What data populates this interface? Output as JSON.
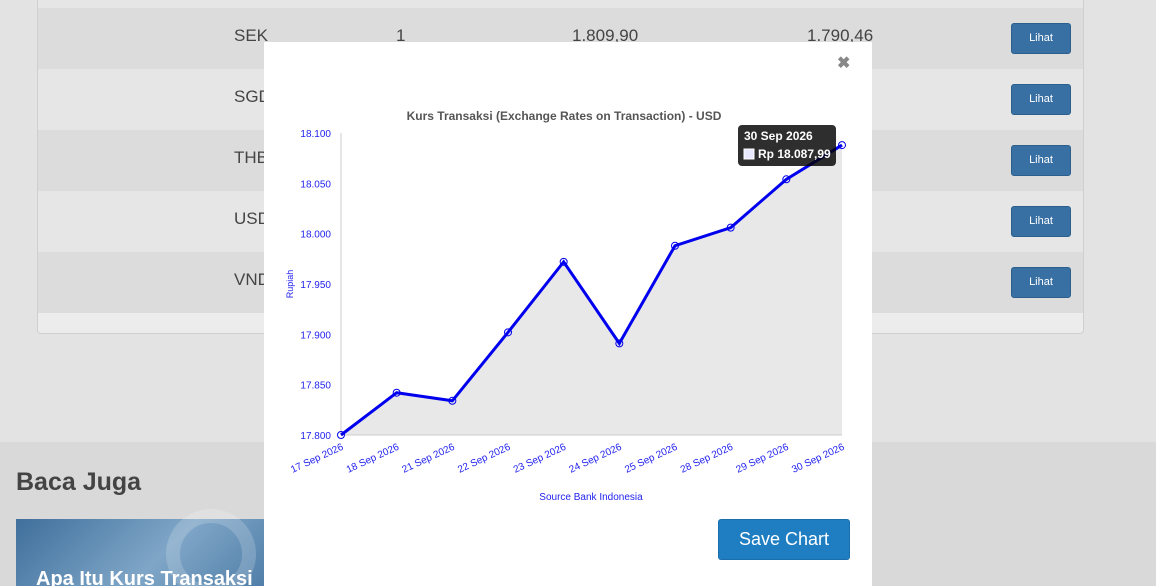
{
  "table": {
    "rows": [
      {
        "code": "SEK",
        "unit": "1",
        "sell": "1.809,90",
        "buy": "1.790,46",
        "button": "Lihat"
      },
      {
        "code": "SGD",
        "unit": "",
        "sell": "",
        "buy": "",
        "button": "Lihat"
      },
      {
        "code": "THB",
        "unit": "",
        "sell": "",
        "buy": "",
        "button": "Lihat"
      },
      {
        "code": "USD",
        "unit": "",
        "sell": "",
        "buy": "",
        "button": "Lihat"
      },
      {
        "code": "VND",
        "unit": "",
        "sell": "",
        "buy": "",
        "button": "Lihat"
      }
    ]
  },
  "baca_juga": {
    "heading": "Baca Juga",
    "card_title": "Apa Itu Kurs Transaksi"
  },
  "modal": {
    "close_icon": "close-icon",
    "save_label": "Save Chart"
  },
  "chart_data": {
    "type": "line",
    "title": "Kurs Transaksi (Exchange Rates on Transaction) - USD",
    "xlabel": "Source Bank Indonesia",
    "ylabel": "Rupiah",
    "categories": [
      "17 Sep 2026",
      "18 Sep 2026",
      "21 Sep 2026",
      "22 Sep 2026",
      "23 Sep 2026",
      "24 Sep 2026",
      "25 Sep 2026",
      "28 Sep 2026",
      "29 Sep 2026",
      "30 Sep 2026"
    ],
    "series": [
      {
        "values": [
          17800,
          17842,
          17834,
          17902,
          17972,
          17891,
          17988,
          18006,
          18054,
          18087.99
        ]
      }
    ],
    "ylim": [
      17800,
      18100
    ],
    "yticks": [
      "17.800",
      "17.850",
      "17.900",
      "17.950",
      "18.000",
      "18.050",
      "18.100"
    ],
    "tooltip": {
      "date": "30 Sep 2026",
      "text": "Rp 18.087,99"
    },
    "colors": {
      "line": "#0000ee",
      "plot_bg": "#e8e8e8",
      "axis_text": "#2222ee",
      "title": "#555555"
    }
  }
}
